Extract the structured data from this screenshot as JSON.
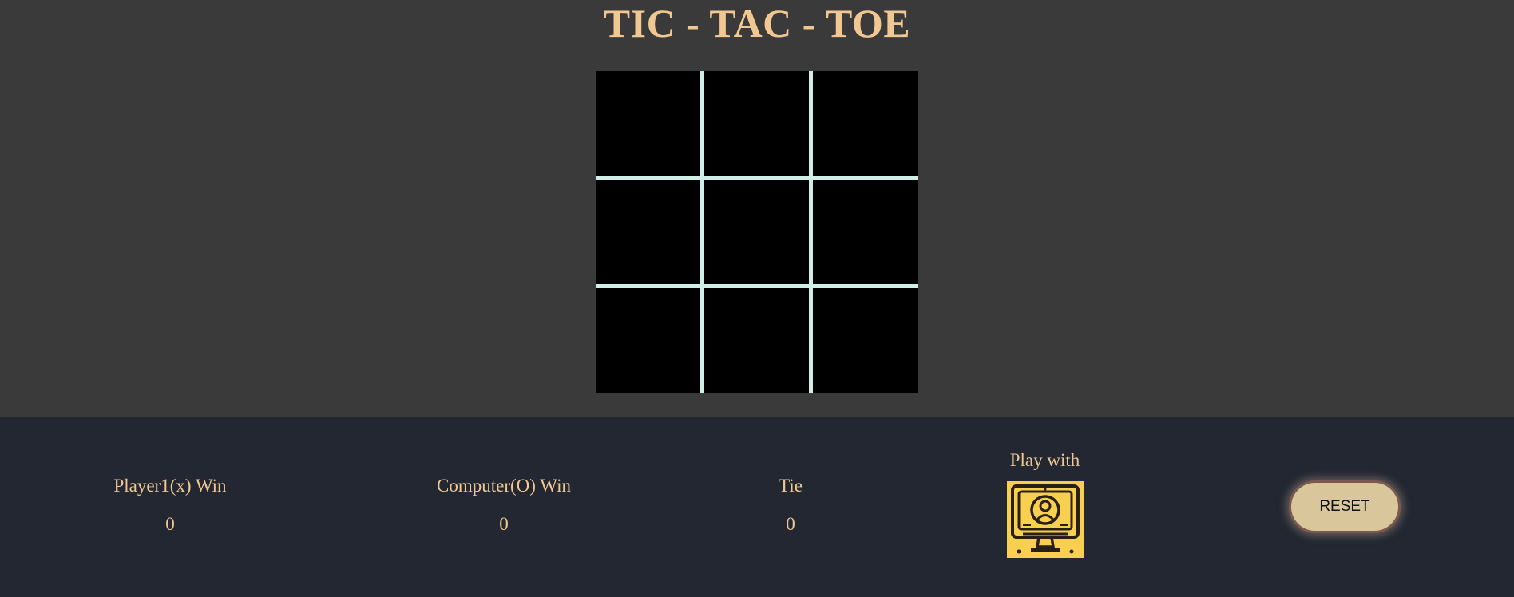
{
  "title": "TIC - TAC - TOE",
  "board": {
    "cells": [
      "",
      "",
      "",
      "",
      "",
      "",
      "",
      "",
      ""
    ]
  },
  "scores": {
    "player1_label": "Player1(x) Win",
    "player1_value": "0",
    "computer_label": "Computer(O) Win",
    "computer_value": "0",
    "tie_label": "Tie",
    "tie_value": "0"
  },
  "mode": {
    "label": "Play with",
    "icon": "computer-user-icon"
  },
  "reset_label": "RESET",
  "colors": {
    "background_top": "#3a3a3a",
    "background_bottom": "#222732",
    "accent_text": "#f2c892",
    "grid_lines": "#cfeee8",
    "cell": "#000000",
    "mode_button": "#f9cf50",
    "reset_button": "#d9c69a"
  }
}
